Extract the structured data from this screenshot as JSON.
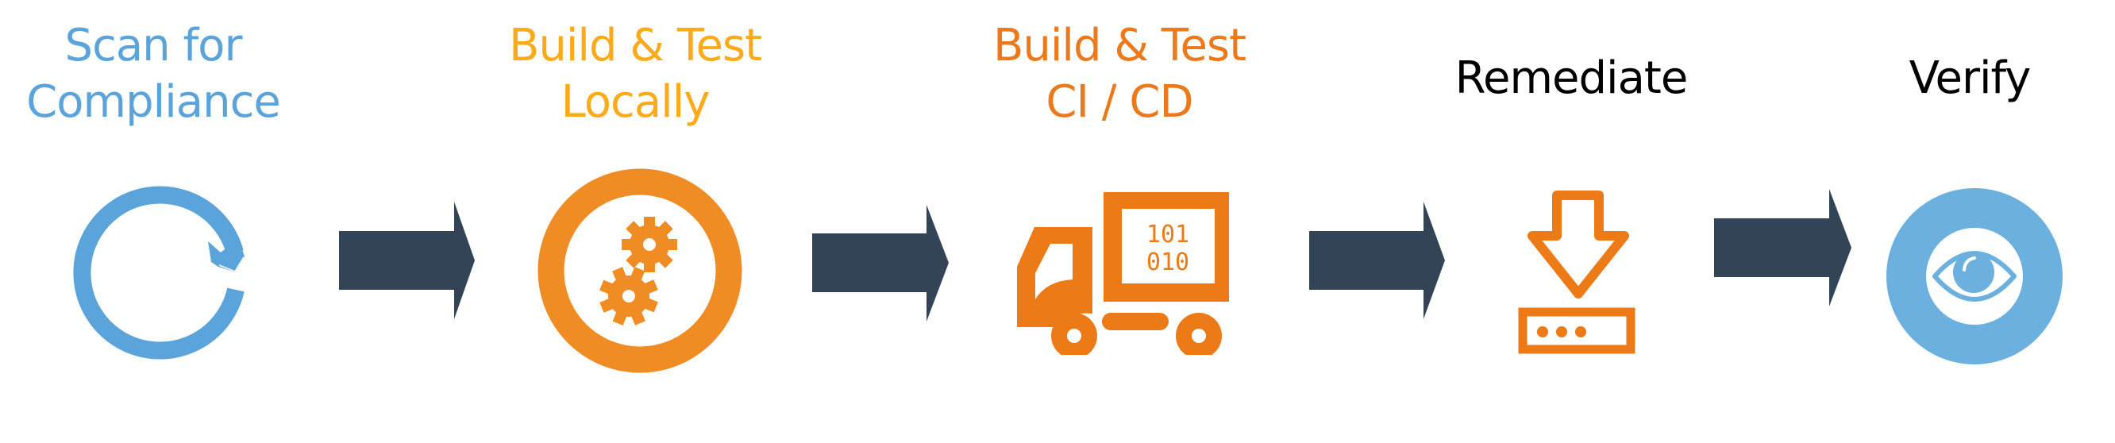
{
  "diagram": {
    "type": "process-flow",
    "steps": [
      {
        "id": "scan",
        "line1": "Scan for",
        "line2": "Compliance",
        "color": "#5BA3DB",
        "icon": "refresh-cycle-icon"
      },
      {
        "id": "build-local",
        "line1": "Build & Test",
        "line2": "Locally",
        "color": "#FBAB1A",
        "icon": "gears-icon"
      },
      {
        "id": "build-ci",
        "line1": "Build & Test",
        "line2": "CI / CD",
        "color": "#EC7A1C",
        "icon": "delivery-truck-icon",
        "binary_top": "101",
        "binary_bottom": "010"
      },
      {
        "id": "remediate",
        "line1": "Remediate",
        "line2": "",
        "color": "#000000",
        "icon": "download-to-server-icon"
      },
      {
        "id": "verify",
        "line1": "Verify",
        "line2": "",
        "color": "#000000",
        "icon": "eye-icon"
      }
    ],
    "connector_color": "#334456",
    "colors": {
      "scan_ring": "#5BA3DB",
      "local_ring": "#F08C24",
      "truck": "#EC7A17",
      "download": "#EC7A17",
      "verify_disc": "#6CB0E0"
    }
  }
}
